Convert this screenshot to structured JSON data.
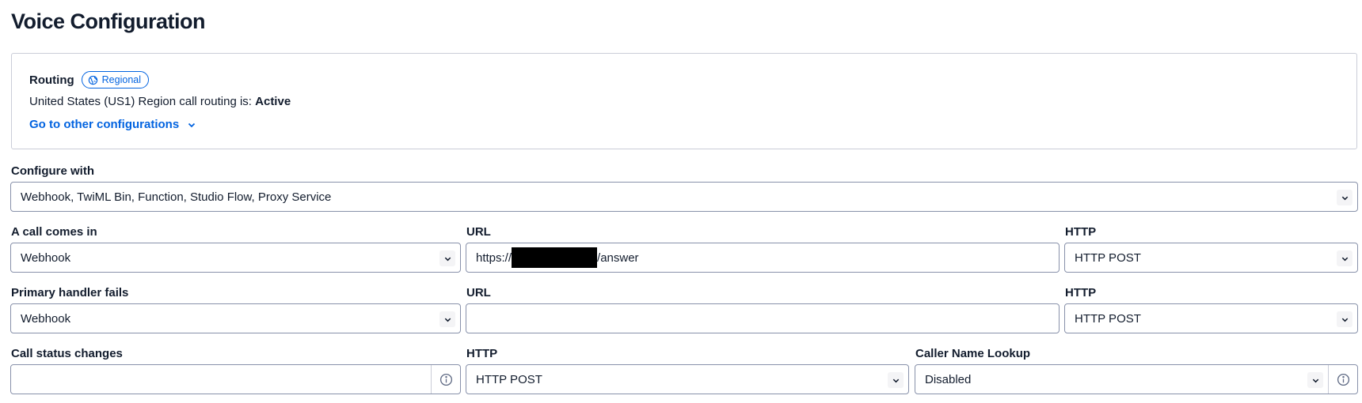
{
  "page": {
    "title": "Voice Configuration"
  },
  "routing": {
    "label": "Routing",
    "badge": "Regional",
    "status_prefix": "United States (US1) Region call routing is: ",
    "status_value": "Active",
    "link": "Go to other configurations"
  },
  "configure_with": {
    "label": "Configure with",
    "value": "Webhook, TwiML Bin, Function, Studio Flow, Proxy Service"
  },
  "call_comes_in": {
    "label": "A call comes in",
    "type": "Webhook",
    "url_label": "URL",
    "url_prefix": "https://",
    "url_suffix": "/answer",
    "http_label": "HTTP",
    "http_value": "HTTP POST"
  },
  "primary_handler_fails": {
    "label": "Primary handler fails",
    "type": "Webhook",
    "url_label": "URL",
    "url_value": "",
    "http_label": "HTTP",
    "http_value": "HTTP POST"
  },
  "call_status_changes": {
    "label": "Call status changes",
    "value": "",
    "http_label": "HTTP",
    "http_value": "HTTP POST"
  },
  "caller_name_lookup": {
    "label": "Caller Name Lookup",
    "value": "Disabled"
  },
  "icons": {
    "badge": "globe-icon",
    "link": "chevron-down-icon",
    "select": "chevron-down-icon",
    "info": "info-circle-icon"
  },
  "colors": {
    "link": "#0263e0",
    "border": "#8891aa",
    "text": "#121c2d"
  }
}
